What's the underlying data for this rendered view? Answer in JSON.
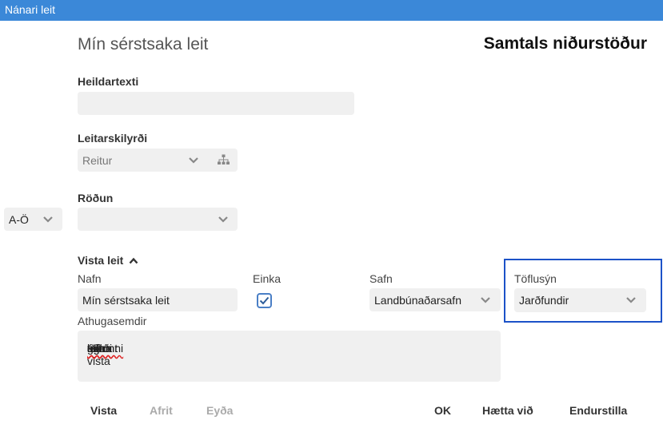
{
  "window": {
    "title": "Nánari leit"
  },
  "header": {
    "left_title": "Mín sérstsaka leit",
    "right_title": "Samtals niðurstöður"
  },
  "search": {
    "fulltext_label": "Heildartexti",
    "fulltext_value": "",
    "criteria_label": "Leitarskilyrði",
    "criteria_placeholder": "Reitur",
    "sort_label": "Röðun",
    "sort_value": "",
    "sort_order": "A-Ö"
  },
  "save": {
    "section_label": "Vista leit",
    "name_label": "Nafn",
    "name_value": "Mín sérstsaka leit",
    "private_label": "Einka",
    "private_checked": true,
    "collection_label": "Safn",
    "collection_value": "Landbúnaðarsafn",
    "table_view_label": "Töflusýn",
    "table_view_value": "Jarðfundir",
    "notes_label": "Athugasemdir",
    "notes_value": "Hér er ég að vista mína leit ásamt töflunni sem ég gerði.",
    "notes_segments": [
      "Hér",
      " er ",
      "ég",
      " að vista ",
      "mína",
      " leit ",
      "ásamt",
      " ",
      "töflunni",
      " sem ",
      "ég",
      " ",
      "gerði",
      "."
    ]
  },
  "footer": {
    "save": "Vista",
    "copy": "Afrit",
    "delete": "Eyða",
    "ok": "OK",
    "cancel": "Hætta við",
    "reset": "Endurstilla"
  },
  "colors": {
    "titlebar": "#3b88d8",
    "highlight": "#1c52c8",
    "checkbox": "#4a7fc6"
  }
}
